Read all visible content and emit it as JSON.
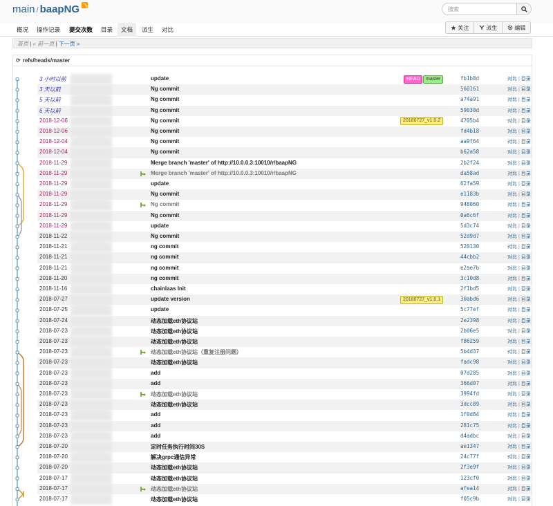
{
  "header": {
    "project": "main",
    "separator": "/",
    "repo": "baapNG",
    "search_placeholder": "搜索"
  },
  "nav": {
    "items": [
      "概况",
      "操作记录",
      "提交次数",
      "目录",
      "文档",
      "派生",
      "对比"
    ]
  },
  "actions": {
    "watch": "★ 关注",
    "fork": "派生",
    "edit": "编辑"
  },
  "pager": {
    "first": "首页",
    "prev": "« 前一页",
    "next": "下一页 »"
  },
  "branch": {
    "ref": "refs/heads/master"
  },
  "commit_links": {
    "compare": "对比",
    "tree": "目录"
  },
  "commits": [
    {
      "date": "3 小时以前",
      "style": "recent",
      "message": "update",
      "sha": "fb1b8d",
      "tags": [
        {
          "label": "HEAD",
          "kind": "head"
        },
        {
          "label": "master",
          "kind": "master"
        }
      ]
    },
    {
      "date": "3 天以前",
      "style": "recent",
      "message": "Ng commit",
      "sha": "560161"
    },
    {
      "date": "5 天以前",
      "style": "recent",
      "message": "Ng commit",
      "sha": "a74a91"
    },
    {
      "date": "6 天以前",
      "style": "recent",
      "message": "Ng commit",
      "sha": "59030d"
    },
    {
      "date": "2018-12-06",
      "style": "mid",
      "message": "Ng commit",
      "sha": "4705b4",
      "tags": [
        {
          "label": "20180727_v1.0.2",
          "kind": "tag"
        }
      ]
    },
    {
      "date": "2018-12-06",
      "style": "mid",
      "message": "Ng commit",
      "sha": "fd4b18"
    },
    {
      "date": "2018-12-04",
      "style": "mid",
      "message": "Ng commit",
      "sha": "aa9f64"
    },
    {
      "date": "2018-12-04",
      "style": "mid",
      "message": "Ng commit",
      "sha": "b62a58"
    },
    {
      "date": "2018-11-29",
      "style": "mid",
      "message": "Merge branch 'master' of http://10.0.0.3:10010/r/baapNG",
      "sha": "2b2f24"
    },
    {
      "date": "2018-11-29",
      "style": "mid",
      "message": "Merge branch 'master' of http://10.0.0.3:10010/r/baapNG",
      "sha": "da58ad",
      "merge": true
    },
    {
      "date": "2018-11-29",
      "style": "mid",
      "message": "update",
      "sha": "62fa59"
    },
    {
      "date": "2018-11-29",
      "style": "mid",
      "message": "Ng commit",
      "sha": "e1183b"
    },
    {
      "date": "2018-11-29",
      "style": "mid",
      "message": "Ng commit",
      "sha": "948060",
      "merge": true
    },
    {
      "date": "2018-11-29",
      "style": "mid",
      "message": "Ng commit",
      "sha": "0a6c6f"
    },
    {
      "date": "2018-11-29",
      "style": "mid",
      "message": "update",
      "sha": "5d3c74"
    },
    {
      "date": "2018-11-22",
      "style": "old",
      "message": "Ng commit",
      "sha": "52d9d7"
    },
    {
      "date": "2018-11-21",
      "style": "old",
      "message": "ng commit",
      "sha": "520130"
    },
    {
      "date": "2018-11-21",
      "style": "old",
      "message": "ng commit",
      "sha": "44cbb2"
    },
    {
      "date": "2018-11-21",
      "style": "old",
      "message": "ng commit",
      "sha": "e2ae7b"
    },
    {
      "date": "2018-11-20",
      "style": "old",
      "message": "ng commit",
      "sha": "3c10d8"
    },
    {
      "date": "2018-11-16",
      "style": "old",
      "message": "chainlaas Init",
      "sha": "2f1bd5"
    },
    {
      "date": "2018-07-27",
      "style": "old",
      "message": "update version",
      "sha": "30abd6",
      "tags": [
        {
          "label": "20180727_v1.0.1",
          "kind": "tag"
        }
      ]
    },
    {
      "date": "2018-07-25",
      "style": "old",
      "message": "update",
      "sha": "5c77ef"
    },
    {
      "date": "2018-07-24",
      "style": "old",
      "message": "动态加载eth协议站",
      "sha": "2e2398"
    },
    {
      "date": "2018-07-23",
      "style": "old",
      "message": "动态加载eth协议站",
      "sha": "2b06e5"
    },
    {
      "date": "2018-07-23",
      "style": "old",
      "message": "动态加载eth协议站",
      "sha": "f86259"
    },
    {
      "date": "2018-07-23",
      "style": "old",
      "message": "动态加载eth协议站（重复注册问题）",
      "sha": "5b4d37",
      "merge": true
    },
    {
      "date": "2018-07-23",
      "style": "old",
      "message": "动态加载eth协议站",
      "sha": "fadc98"
    },
    {
      "date": "2018-07-23",
      "style": "old",
      "message": "add",
      "sha": "07d285"
    },
    {
      "date": "2018-07-23",
      "style": "old",
      "message": "add",
      "sha": "366d07"
    },
    {
      "date": "2018-07-23",
      "style": "old",
      "message": "动态加载eth协议站",
      "sha": "3994fd",
      "merge": true
    },
    {
      "date": "2018-07-23",
      "style": "old",
      "message": "动态加载eth协议站",
      "sha": "3dcc89"
    },
    {
      "date": "2018-07-23",
      "style": "old",
      "message": "add",
      "sha": "1f0d84"
    },
    {
      "date": "2018-07-23",
      "style": "old",
      "message": "add",
      "sha": "281c75"
    },
    {
      "date": "2018-07-23",
      "style": "old",
      "message": "add",
      "sha": "d4adbc"
    },
    {
      "date": "2018-07-20",
      "style": "old",
      "message": "定时任务执行时间30S",
      "sha": "ae1347"
    },
    {
      "date": "2018-07-20",
      "style": "old",
      "message": "解决grpc通信异常",
      "sha": "24c77f"
    },
    {
      "date": "2018-07-20",
      "style": "old",
      "message": "动态加载eth协议站",
      "sha": "2f3e9f"
    },
    {
      "date": "2018-07-17",
      "style": "old",
      "message": "动态加载eth协议站",
      "sha": "123cf0"
    },
    {
      "date": "2018-07-17",
      "style": "old",
      "message": "动态加载eth协议站",
      "sha": "afea14",
      "merge": true
    },
    {
      "date": "2018-07-17",
      "style": "old",
      "message": "动态加载eth协议站",
      "sha": "f05c9b"
    }
  ]
}
